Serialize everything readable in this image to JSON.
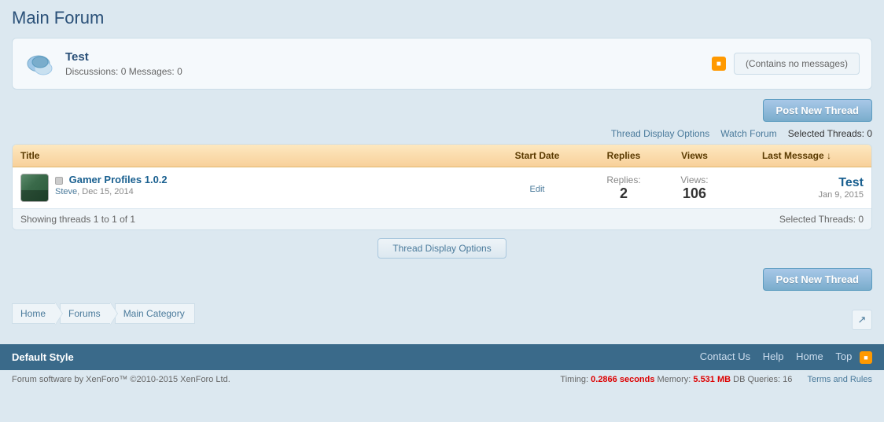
{
  "page": {
    "title": "Main Forum"
  },
  "forum": {
    "name": "Test",
    "discussions_label": "Discussions:",
    "discussions_count": "0",
    "messages_label": "Messages:",
    "messages_count": "0",
    "no_messages": "(Contains no messages)"
  },
  "toolbar": {
    "post_new_label": "Post New Thread"
  },
  "options": {
    "thread_display_options": "Thread Display Options",
    "watch_forum": "Watch Forum",
    "selected_threads_label": "Selected Threads:",
    "selected_threads_count": "0"
  },
  "table": {
    "headers": {
      "title": "Title",
      "start_date": "Start Date",
      "replies": "Replies",
      "views": "Views",
      "last_message": "Last Message ↓"
    },
    "threads": [
      {
        "id": 1,
        "name": "Gamer Profiles 1.0.2",
        "author": "Steve",
        "date": "Dec 15, 2014",
        "replies_label": "Replies:",
        "replies": "2",
        "views_label": "Views:",
        "views": "106",
        "last_message_user": "Test",
        "last_message_date": "Jan 9, 2015",
        "edit_label": "Edit"
      }
    ],
    "showing": "Showing threads 1 to 1 of 1",
    "selected_threads": "Selected Threads: 0"
  },
  "thread_display_options_btn": "Thread Display Options",
  "breadcrumb": {
    "items": [
      {
        "label": "Home"
      },
      {
        "label": "Forums"
      },
      {
        "label": "Main Category"
      }
    ]
  },
  "footer_bar": {
    "style": "Default Style",
    "links": [
      {
        "label": "Contact Us"
      },
      {
        "label": "Help"
      },
      {
        "label": "Home"
      },
      {
        "label": "Top"
      }
    ]
  },
  "footer_bottom": {
    "copyright": "Forum software by XenForo™ ©2010-2015 XenForo Ltd.",
    "timing_prefix": "Timing:",
    "timing_value": "0.2866 seconds",
    "memory_prefix": "Memory:",
    "memory_value": "5.531 MB",
    "db_prefix": "DB Queries:",
    "db_value": "16",
    "terms_link": "Terms and Rules"
  }
}
